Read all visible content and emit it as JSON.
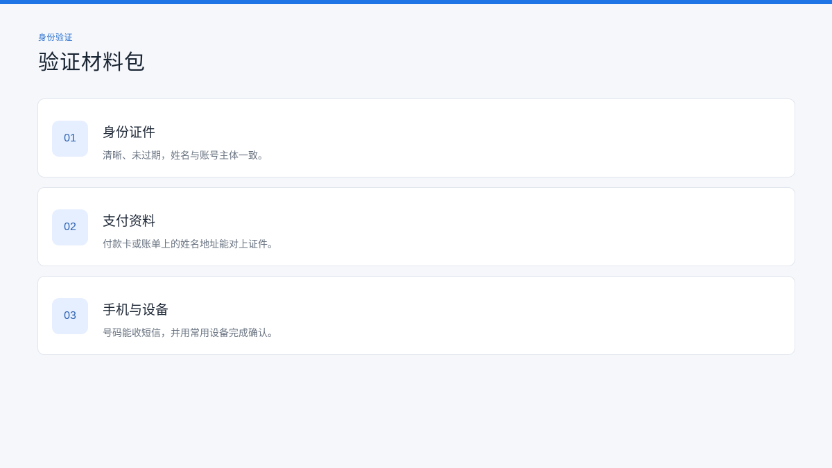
{
  "header": {
    "eyebrow": "身份验证",
    "title": "验证材料包"
  },
  "items": [
    {
      "index": "01",
      "title": "身份证件",
      "description": "清晰、未过期，姓名与账号主体一致。"
    },
    {
      "index": "02",
      "title": "支付资料",
      "description": "付款卡或账单上的姓名地址能对上证件。"
    },
    {
      "index": "03",
      "title": "手机与设备",
      "description": "号码能收短信，并用常用设备完成确认。"
    }
  ],
  "colors": {
    "accent": "#1f75e6",
    "background": "#f5f7fb",
    "badge_bg": "#e6efff"
  }
}
